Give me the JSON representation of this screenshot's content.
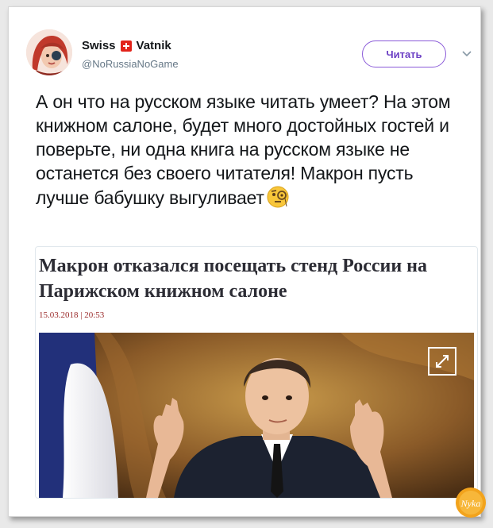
{
  "tweet": {
    "author_name_part1": "Swiss",
    "author_name_part2": "Vatnik",
    "handle": "@NoRussiaNoGame",
    "follow_label": "Читать",
    "text": "А он что на русском языке читать умеет? На этом книжном салоне, будет много достойных гостей и поверьте, ни одна книга на русском языке не останется без своего читателя! Макрон пусть лучше бабушку выгуливает",
    "emoji": "face-with-monocle-icon"
  },
  "card": {
    "title": "Макрон отказался посещать стенд России на Парижском книжном салоне",
    "date": "15.03.2018 | 20:53",
    "image": "photo-of-man-in-suit-with-french-flag",
    "expand_icon": "expand-icon"
  },
  "watermark": {
    "text": "Nyka"
  },
  "colors": {
    "follow_border": "#8a5ad8",
    "follow_text": "#6b3fc4",
    "handle": "#657786",
    "date": "#9b2a2a",
    "flag": "#e2231a"
  }
}
